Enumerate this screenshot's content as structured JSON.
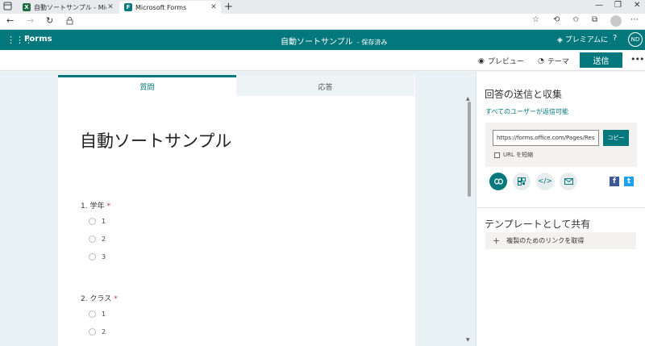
{
  "browser": {
    "tabs": [
      {
        "title": "自動ソートサンプル - Microsoft Exce",
        "favicon": "excel-icon",
        "color": "#1d6f42",
        "active": false
      },
      {
        "title": "Microsoft Forms",
        "favicon": "forms-icon",
        "color": "#03787c",
        "active": true
      }
    ],
    "icons": {
      "new_tab": "plus-icon",
      "back": "back-arrow-icon",
      "forward": "forward-arrow-icon",
      "refresh": "refresh-icon",
      "lock": "lock-icon",
      "favorite": "star-icon",
      "collections": "collections-icon",
      "profile": "profile-icon"
    }
  },
  "app": {
    "name": "Forms",
    "doc_title": "自動ソートサンプル",
    "save_status": "- 保存済み",
    "premium": "プレミアムに",
    "help": "?",
    "avatar_initials": "ND",
    "accent": "#03787c"
  },
  "commands": {
    "preview": "プレビュー",
    "theme": "テーマ",
    "send": "送信",
    "more": "•••"
  },
  "form": {
    "tabs": [
      "質問",
      "応答"
    ],
    "title": "自動ソートサンプル",
    "questions": [
      {
        "label": "1. 学年",
        "required": "*",
        "options": [
          "1",
          "2",
          "3"
        ]
      },
      {
        "label": "2. クラス",
        "required": "*",
        "options": [
          "1",
          "2"
        ]
      }
    ]
  },
  "side_panel": {
    "heading": "回答の送信と収集",
    "audience": "すべてのユーザーが返信可能",
    "url": "https://forms.office.com/Pages/Respon",
    "copy": "コピー",
    "shorten": "URL を短縮",
    "share_icons": [
      "link-icon",
      "qr-code-icon",
      "embed-icon",
      "email-icon"
    ],
    "social": {
      "facebook": "f",
      "twitter": "t",
      "facebook_color": "#3b5998",
      "twitter_color": "#1da1f2"
    },
    "template_heading": "テンプレートとして共有",
    "duplicate_link": "複製のためのリンクを取得",
    "plus": "+"
  }
}
